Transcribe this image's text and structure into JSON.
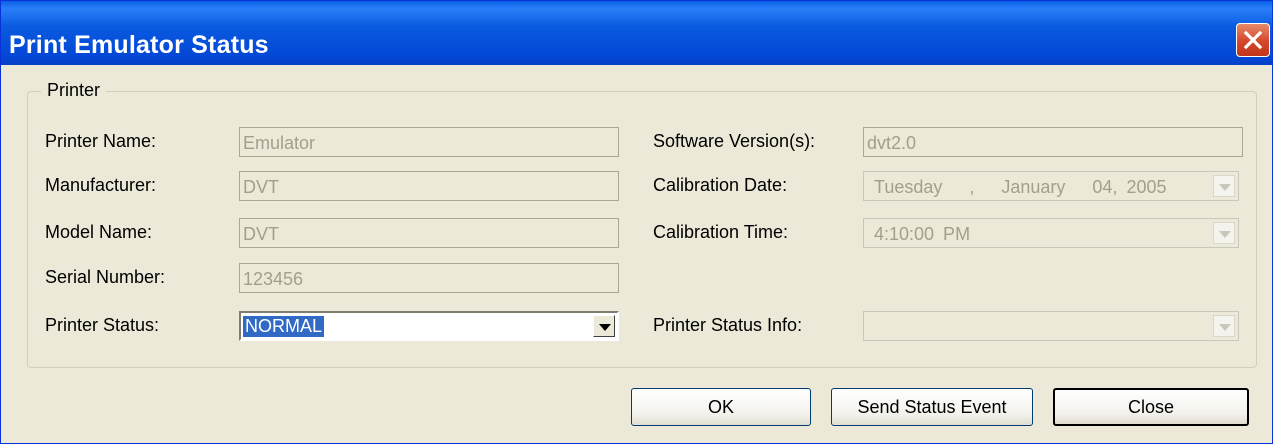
{
  "window": {
    "title": "Print Emulator Status"
  },
  "group": {
    "legend": "Printer"
  },
  "left_fields": {
    "printer_name": {
      "label": "Printer Name:",
      "value": "Emulator"
    },
    "manufacturer": {
      "label": "Manufacturer:",
      "value": "DVT"
    },
    "model_name": {
      "label": "Model Name:",
      "value": "DVT"
    },
    "serial_number": {
      "label": "Serial Number:",
      "value": "123456"
    },
    "printer_status": {
      "label": "Printer Status:",
      "value": "NORMAL"
    }
  },
  "right_fields": {
    "software_version": {
      "label": "Software Version(s):",
      "value": "dvt2.0"
    },
    "calibration_date": {
      "label": "Calibration Date:",
      "value": "Tuesday   ,   January   04, 2005"
    },
    "calibration_time": {
      "label": "Calibration Time:",
      "value": "4:10:00 PM"
    },
    "printer_status_info": {
      "label": "Printer Status Info:",
      "value": ""
    }
  },
  "buttons": {
    "ok": "OK",
    "send_status_event": "Send Status Event",
    "close": "Close"
  },
  "icons": {
    "close": "close-x-icon",
    "dropdown": "chevron-down-icon"
  }
}
